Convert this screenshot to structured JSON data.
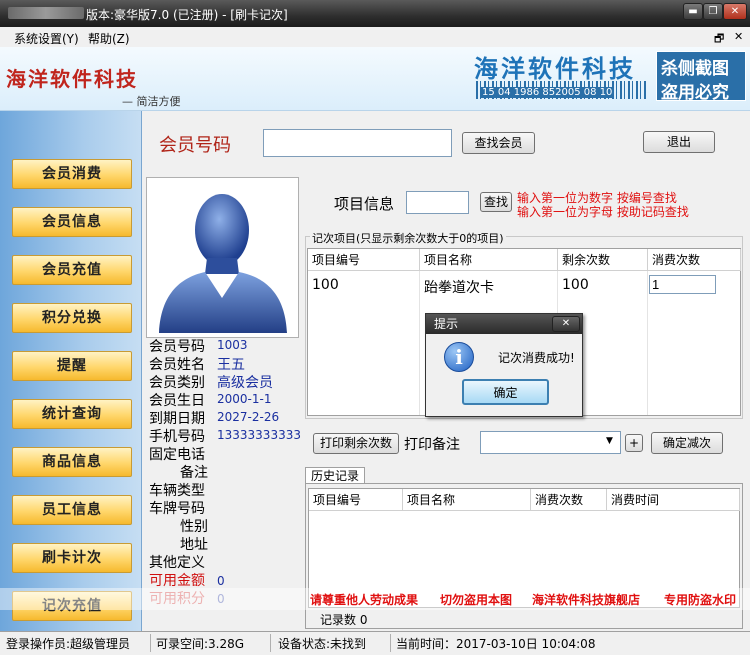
{
  "window": {
    "title": "版本:豪华版7.0 (已注册) - [刷卡记次]",
    "min": "▬",
    "max": "❐",
    "close": "✕"
  },
  "menu": {
    "settings": "系统设置(Y)",
    "help": "帮助(Z)",
    "restore": "🗗",
    "close": "✕"
  },
  "banner": {
    "logo": "海洋软件科技",
    "slogan": "— 简洁方便",
    "brand": "海洋软件科技",
    "barcode": "15 04 1986 852005 08 10",
    "stamp_line1": "杀侧截图",
    "stamp_line2": "盗用必究"
  },
  "nav": [
    "会员消费",
    "会员信息",
    "会员充值",
    "积分兑换",
    "提醒",
    "统计查询",
    "商品信息",
    "员工信息",
    "刷卡计次",
    "记次充值"
  ],
  "member_search": {
    "label": "会员号码",
    "value": "",
    "search_btn": "查找会员",
    "exit_btn": "退出"
  },
  "member": {
    "fields": [
      {
        "label": "会员号码",
        "value": "1003"
      },
      {
        "label": "会员姓名",
        "value": "王五"
      },
      {
        "label": "会员类别",
        "value": "高级会员"
      },
      {
        "label": "会员生日",
        "value": "2000-1-1"
      },
      {
        "label": "到期日期",
        "value": "2027-2-26"
      },
      {
        "label": "手机号码",
        "value": "13333333333"
      },
      {
        "label": "固定电话",
        "value": ""
      },
      {
        "label": "备注",
        "value": ""
      },
      {
        "label": "车辆类型",
        "value": ""
      },
      {
        "label": "车牌号码",
        "value": ""
      },
      {
        "label": "性别",
        "value": ""
      },
      {
        "label": "地址",
        "value": ""
      },
      {
        "label": "其他定义",
        "value": ""
      },
      {
        "label": "可用金额",
        "value": "0"
      },
      {
        "label": "可用积分",
        "value": "0"
      }
    ]
  },
  "item_search": {
    "label": "项目信息",
    "value": "",
    "btn": "查找",
    "hint1": "输入第一位为数字 按编号查找",
    "hint2": "输入第一位为字母 按助记码查找"
  },
  "counting": {
    "group_title": "记次项目(只显示剩余次数大于0的项目)",
    "headers": [
      "项目编号",
      "项目名称",
      "剩余次数",
      "消费次数"
    ],
    "rows": [
      [
        "100",
        "跆拳道次卡",
        "100",
        "1"
      ]
    ]
  },
  "dialog": {
    "title": "提示",
    "message": "记次消费成功!",
    "ok": "确定",
    "close": "✕"
  },
  "actions": {
    "print_remaining": "打印剩余次数",
    "print_note_label": "打印备注",
    "print_note_value": "",
    "plus": "+",
    "confirm": "确定减次"
  },
  "history": {
    "tab": "历史记录",
    "headers": [
      "项目编号",
      "项目名称",
      "消费次数",
      "消费时间"
    ],
    "record_count": "记录数 0"
  },
  "watermark": [
    "请尊重他人劳动成果",
    "切勿盗用本图",
    "海洋软件科技旗舰店",
    "专用防盗水印"
  ],
  "status": {
    "operator": "登录操作员:超级管理员",
    "space": "可录空间:3.28G",
    "device": "设备状态:未找到",
    "time": "当前时间：2017-03-10日 10:04:08"
  },
  "colors": {
    "hint_red": "#e01010",
    "value_blue": "#1a2fa0",
    "nav_gold": "#f6b92e",
    "banner_blue": "#1e73b8"
  }
}
